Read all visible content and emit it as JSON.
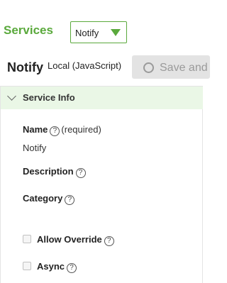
{
  "header": {
    "services_label": "Services",
    "service_select_value": "Notify"
  },
  "title_row": {
    "name": "Notify",
    "type": "Local (JavaScript)",
    "save_label": "Save and"
  },
  "panel": {
    "title": "Service Info",
    "name_label": "Name",
    "required_text": "(required)",
    "name_value": "Notify",
    "description_label": "Description",
    "category_label": "Category",
    "allow_override_label": "Allow Override",
    "async_label": "Async",
    "help_glyph": "?"
  },
  "colors": {
    "accent_green": "#5aa93c",
    "panel_header_bg": "#eaf7e6"
  }
}
